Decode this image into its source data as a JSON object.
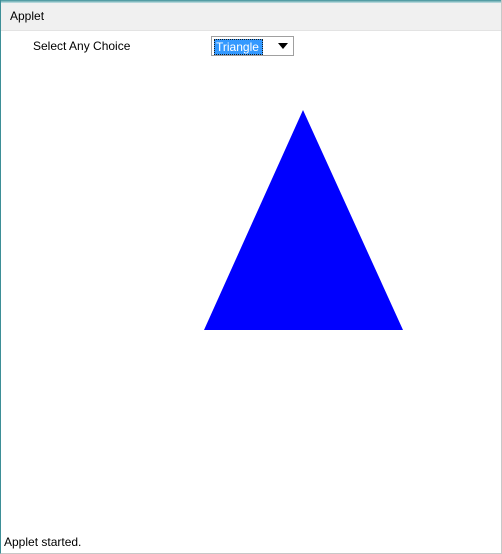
{
  "menu": {
    "title": "Applet"
  },
  "choice": {
    "label": "Select Any Choice",
    "selected": "Triangle"
  },
  "shape": {
    "fill": "#0000ff"
  },
  "status": {
    "text": "Applet started."
  }
}
